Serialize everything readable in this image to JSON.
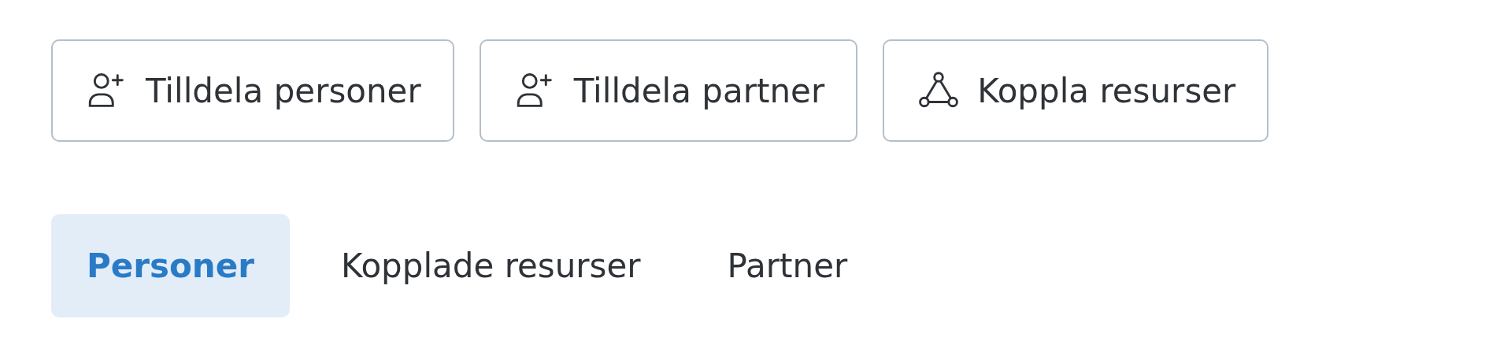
{
  "actions": [
    {
      "kind": "person",
      "label": "Tilldela personer"
    },
    {
      "kind": "person",
      "label": "Tilldela partner"
    },
    {
      "kind": "network",
      "label": "Koppla resurser"
    }
  ],
  "tabs": [
    {
      "label": "Personer",
      "selected": true
    },
    {
      "label": "Kopplade resurser",
      "selected": false
    },
    {
      "label": "Partner",
      "selected": false
    }
  ]
}
